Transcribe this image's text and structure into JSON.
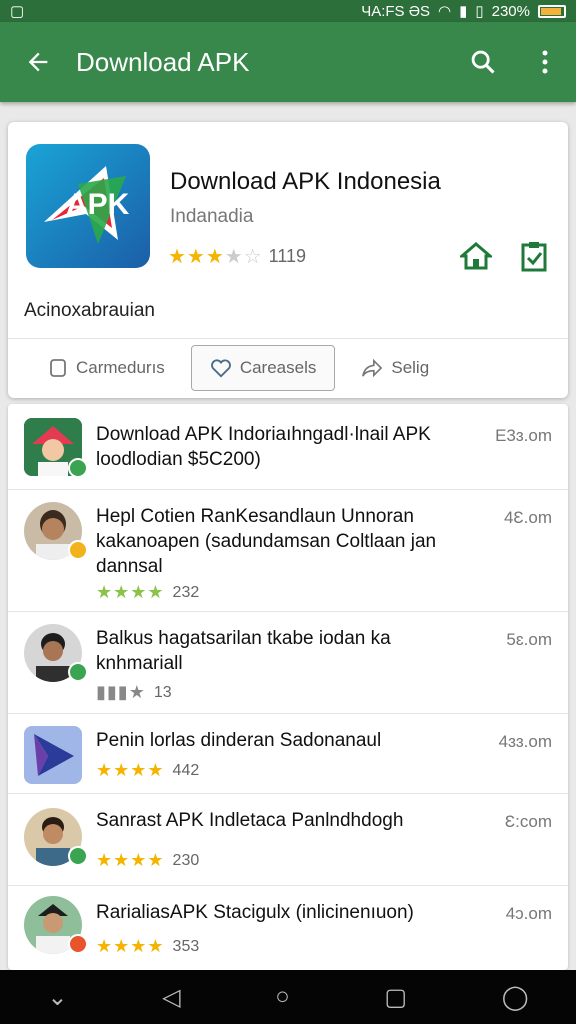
{
  "status_bar": {
    "left_icon": "notification-icon",
    "carrier": "ЧА:FЅ ƏЅ",
    "battery_pct": "230%"
  },
  "app_bar": {
    "title": "Download APK",
    "back_icon": "arrow-left-icon",
    "search_icon": "search-icon",
    "more_icon": "more-vert-icon"
  },
  "app_card": {
    "name": "Download APK Indonesia",
    "developer": "Indanadia",
    "rating": "3.5",
    "rating_count": "1119",
    "description": "Acinoxabrauian",
    "icons": [
      "home-icon",
      "clipboard-check-icon"
    ],
    "tabs": [
      {
        "label": "Carmedurıs",
        "icon": "bookmark-icon"
      },
      {
        "label": "Careasels",
        "icon": "heart-icon"
      },
      {
        "label": "Selig",
        "icon": "share-icon"
      }
    ]
  },
  "list_items": [
    {
      "title": "Download APK Indoriaıhngadl·lnail APK loodlodian $5C200)",
      "time": "E3ɜ.om",
      "rating": "",
      "count": ""
    },
    {
      "title": "Hepl Cotien RanKesandlaun Unnoran kakanoapen (sadundamsan Coltlaan jan dannsal",
      "time": "4Ɛ.om",
      "rating": "4",
      "count": "232"
    },
    {
      "title": "Balkus hagatsarilan tkabe iodan ka knhmariall",
      "time": "5ɛ.om",
      "rating": "3",
      "count": "13"
    },
    {
      "title": "Penin lorlas dinderan Sadonanaul",
      "time": "4ɜɜ.om",
      "rating": "4",
      "count": "442"
    },
    {
      "title": "Sanrast APK Indletaca Panlndhdogh",
      "time": "Ɛ:com",
      "rating": "4",
      "count": "230"
    },
    {
      "title": "RarialiasAPK Stacigulx (inlicinenıuon)",
      "time": "4ɔ.om",
      "rating": "4",
      "count": "353"
    }
  ],
  "nav_bar": {
    "icons": [
      "chevron-down-icon",
      "back-triangle-icon",
      "home-circle-icon",
      "recents-square-icon",
      "circle-icon"
    ]
  },
  "colors": {
    "primary": "#37884a",
    "status": "#2c6f3b",
    "star": "#f4b400",
    "accent": "#1f7a3a"
  }
}
